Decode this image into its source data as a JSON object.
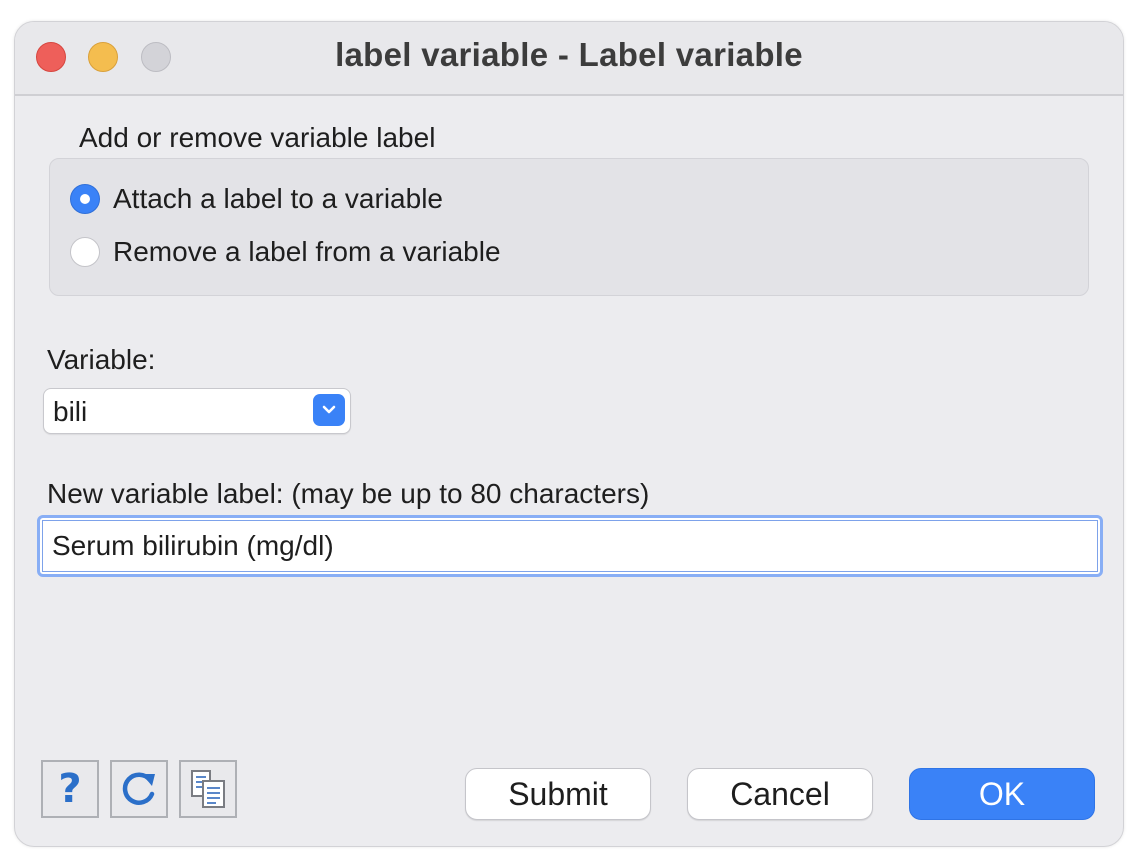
{
  "window": {
    "title": "label variable - Label variable"
  },
  "group": {
    "label": "Add or remove variable label",
    "options": [
      {
        "label": "Attach a label to a variable",
        "selected": true
      },
      {
        "label": "Remove a label from a variable",
        "selected": false
      }
    ]
  },
  "variable": {
    "label": "Variable:",
    "value": "bili"
  },
  "new_label": {
    "label": "New variable label: (may be up to 80 characters)",
    "value": "Serum bilirubin (mg/dl)"
  },
  "toolbar": {
    "help_icon": "question-mark-icon",
    "reset_icon": "refresh-icon",
    "copy_icon": "copy-command-icon"
  },
  "buttons": {
    "submit": "Submit",
    "cancel": "Cancel",
    "ok": "OK"
  },
  "colors": {
    "accent": "#3a82f7",
    "close": "#ee5f5a",
    "minimize": "#f4bd4f",
    "zoom": "#d3d3d8"
  }
}
